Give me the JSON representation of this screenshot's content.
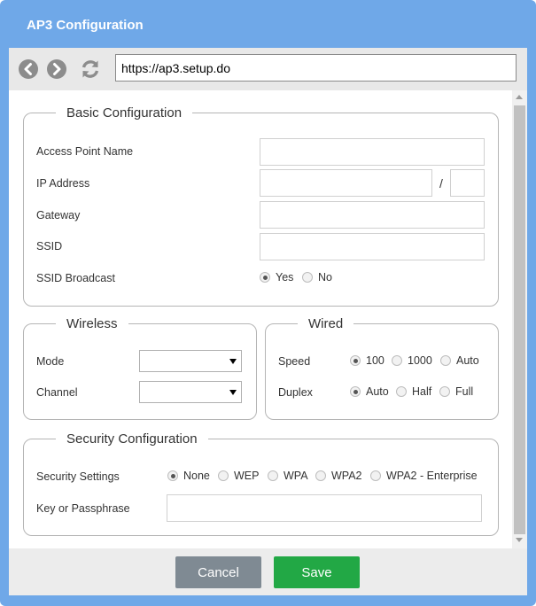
{
  "window": {
    "title": "AP3 Configuration"
  },
  "browser": {
    "url": "https://ap3.setup.do",
    "icons": {
      "back": "back-arrow-icon",
      "forward": "forward-arrow-icon",
      "refresh": "refresh-icon"
    }
  },
  "basic": {
    "legend": "Basic Configuration",
    "ap_name_label": "Access Point Name",
    "ip_label": "IP Address",
    "ip_separator": "/",
    "gateway_label": "Gateway",
    "ssid_label": "SSID",
    "ssid_broadcast_label": "SSID Broadcast",
    "ssid_broadcast_options": [
      "Yes",
      "No"
    ],
    "ssid_broadcast_selected": "Yes",
    "values": {
      "ap_name": "",
      "ip": "",
      "prefix": "",
      "gateway": "",
      "ssid": ""
    }
  },
  "wireless": {
    "legend": "Wireless",
    "mode_label": "Mode",
    "channel_label": "Channel",
    "mode_value": "",
    "channel_value": ""
  },
  "wired": {
    "legend": "Wired",
    "speed_label": "Speed",
    "speed_options": [
      "100",
      "1000",
      "Auto"
    ],
    "speed_selected": "100",
    "duplex_label": "Duplex",
    "duplex_options": [
      "Auto",
      "Half",
      "Full"
    ],
    "duplex_selected": "Auto"
  },
  "security": {
    "legend": "Security Configuration",
    "settings_label": "Security Settings",
    "options": [
      "None",
      "WEP",
      "WPA",
      "WPA2",
      "WPA2 - Enterprise"
    ],
    "selected": "None",
    "key_label": "Key or Passphrase",
    "key_value": ""
  },
  "footer": {
    "cancel": "Cancel",
    "save": "Save"
  },
  "colors": {
    "frame": "#6fa8e8",
    "cancel": "#7f8a93",
    "save": "#22a845",
    "toolbar": "#e8e8e8"
  }
}
